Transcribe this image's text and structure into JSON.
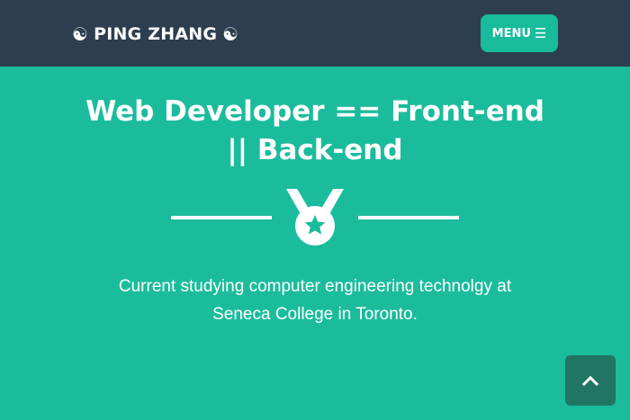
{
  "navbar": {
    "brand": {
      "icon_left": "☯",
      "name": "PING ZHANG",
      "icon_right": "☯"
    },
    "menu_button": {
      "label": "MENU",
      "icon": "☰"
    }
  },
  "hero": {
    "title_line1": "Web Developer == Front-end",
    "title_line2": "|| Back-end",
    "divider_icon": "medal-star-icon",
    "description_line1": "Current studying computer engineering technolgy at",
    "description_line2": "Seneca College in Toronto."
  },
  "scroll_top": {
    "icon": "chevron-up-icon"
  },
  "colors": {
    "navbar_bg": "#2c3e50",
    "accent": "#18bc9c",
    "page_bg": "#1abc9c",
    "scroll_button_bg": "#217565",
    "text": "#ffffff"
  }
}
